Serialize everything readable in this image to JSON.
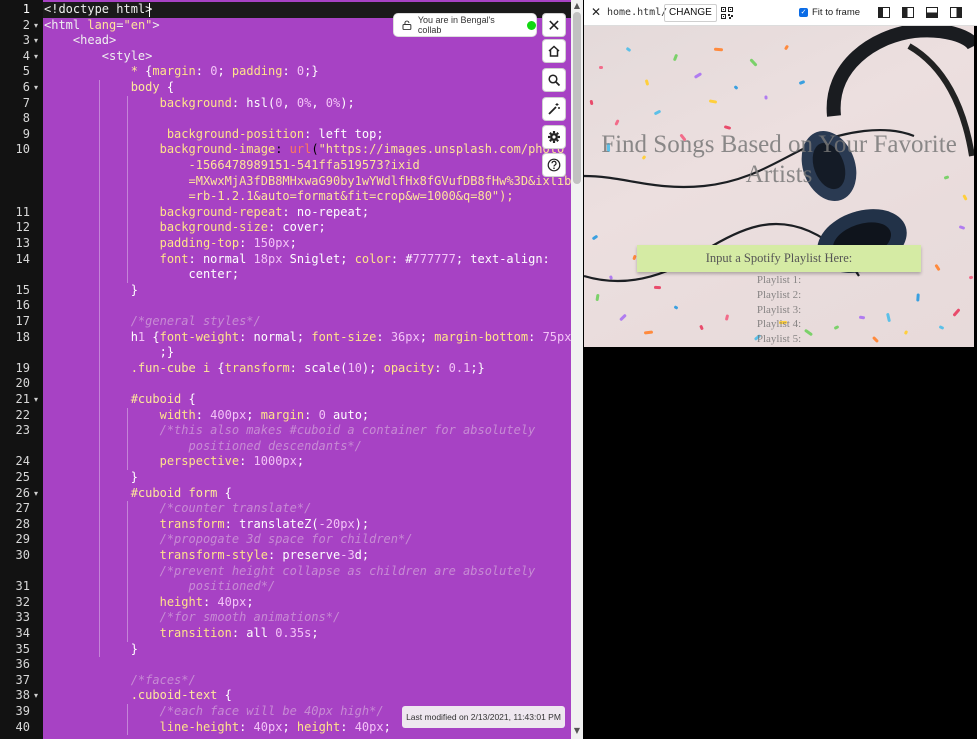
{
  "editor": {
    "line_numbers": [
      "1",
      "2",
      "3",
      "4",
      "5",
      "6",
      "7",
      "8",
      "9",
      "10",
      "11",
      "12",
      "13",
      "14",
      "15",
      "16",
      "17",
      "18",
      "19",
      "20",
      "21",
      "22",
      "23",
      "24",
      "25",
      "26",
      "27",
      "28",
      "29",
      "30",
      "31",
      "32",
      "33",
      "34",
      "35",
      "36",
      "37",
      "38",
      "39",
      "40"
    ],
    "lines": [
      "<!doctype html>",
      "<html lang=\"en\">",
      "    <head>",
      "        <style>",
      "            * {margin: 0; padding: 0;}",
      "            body {",
      "                background: hsl(0, 0%, 0%);",
      "",
      "                 background-position: left top;",
      "                background-image: url(\"https://images.unsplash.com/photo",
      "                    -1566478989151-541ffa519573?ixid",
      "                    =MXwxMjA3fDB8MHxwaG90by1wYWdlfHx8fGVufDB8fHw%3D&ixlib",
      "                    =rb-1.2.1&auto=format&fit=crop&w=1000&q=80\");",
      "                background-repeat: no-repeat;",
      "                background-size: cover;",
      "                padding-top: 150px;",
      "                font: normal 18px Sniglet; color: #777777; text-align:",
      "                    center;",
      "            }",
      "",
      "            /*general styles*/",
      "            h1 {font-weight: normal; font-size: 36px; margin-bottom: 75px",
      "                ;}",
      "            .fun-cube i {transform: scale(10); opacity: 0.1;}",
      "",
      "            #cuboid {",
      "                width: 400px; margin: 0 auto;",
      "                /*this also makes #cuboid a container for absolutely",
      "                    positioned descendants*/",
      "                perspective: 1000px;",
      "            }",
      "            #cuboid form {",
      "                /*counter translate*/",
      "                transform: translateZ(-20px);",
      "                /*propogate 3d space for children*/",
      "                transform-style: preserve-3d;",
      "                /*prevent height collapse as children are absolutely",
      "                    positioned*/",
      "                height: 40px;",
      "                /*for smooth animations*/",
      "                transition: all 0.35s;",
      "            }",
      "",
      "            /*faces*/",
      "            .cuboid-text {",
      "                /*each face will be 40px high*/",
      "                line-height: 40px; height: 40px;"
    ],
    "collab_text": "You are in Bengal's collab",
    "last_modified": "Last modified on 2/13/2021, 11:43:01 PM"
  },
  "preview_bar": {
    "file": "home.html/",
    "change_label": "CHANGE",
    "fit_label": "Fit to frame"
  },
  "preview": {
    "title": "Find Songs Based on Your Favorite Artists",
    "input_label": "Input a Spotify Playlist Here:",
    "playlists": [
      "Playlist 1:",
      "Playlist 2:",
      "Playlist 3:",
      "Playlist 4:",
      "Playlist 5:"
    ]
  },
  "colors": {
    "editor_bg": "#a742c4",
    "gutter_bg": "#121212",
    "input_box": "#d5eba4",
    "collab_dot": "#12d812"
  }
}
